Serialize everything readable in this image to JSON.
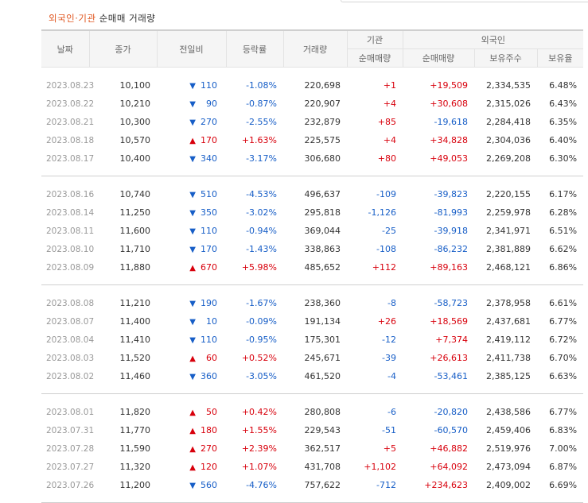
{
  "title": {
    "highlight": "외국인·기관",
    "rest": "순매매 거래량"
  },
  "headers": {
    "date": "날짜",
    "close": "종가",
    "change": "전일비",
    "rate": "등락률",
    "volume": "거래량",
    "institution": "기관",
    "foreign": "외국인",
    "inst_net": "순매매량",
    "frgn_net": "순매매량",
    "frgn_hold": "보유주수",
    "frgn_ratio": "보유율"
  },
  "colors": {
    "up": "#d8000c",
    "down": "#175ec7",
    "title_accent": "#e0561f"
  },
  "groups": [
    [
      {
        "date": "2023.08.23",
        "close": "10,100",
        "dir": "down",
        "change": "110",
        "rate": "-1.08%",
        "volume": "220,698",
        "inst": "+1",
        "frgn": "+19,509",
        "hold": "2,334,535",
        "ratio": "6.48%"
      },
      {
        "date": "2023.08.22",
        "close": "10,210",
        "dir": "down",
        "change": "90",
        "rate": "-0.87%",
        "volume": "220,907",
        "inst": "+4",
        "frgn": "+30,608",
        "hold": "2,315,026",
        "ratio": "6.43%"
      },
      {
        "date": "2023.08.21",
        "close": "10,300",
        "dir": "down",
        "change": "270",
        "rate": "-2.55%",
        "volume": "232,879",
        "inst": "+85",
        "frgn": "-19,618",
        "hold": "2,284,418",
        "ratio": "6.35%"
      },
      {
        "date": "2023.08.18",
        "close": "10,570",
        "dir": "up",
        "change": "170",
        "rate": "+1.63%",
        "volume": "225,575",
        "inst": "+4",
        "frgn": "+34,828",
        "hold": "2,304,036",
        "ratio": "6.40%"
      },
      {
        "date": "2023.08.17",
        "close": "10,400",
        "dir": "down",
        "change": "340",
        "rate": "-3.17%",
        "volume": "306,680",
        "inst": "+80",
        "frgn": "+49,053",
        "hold": "2,269,208",
        "ratio": "6.30%"
      }
    ],
    [
      {
        "date": "2023.08.16",
        "close": "10,740",
        "dir": "down",
        "change": "510",
        "rate": "-4.53%",
        "volume": "496,637",
        "inst": "-109",
        "frgn": "-39,823",
        "hold": "2,220,155",
        "ratio": "6.17%"
      },
      {
        "date": "2023.08.14",
        "close": "11,250",
        "dir": "down",
        "change": "350",
        "rate": "-3.02%",
        "volume": "295,818",
        "inst": "-1,126",
        "frgn": "-81,993",
        "hold": "2,259,978",
        "ratio": "6.28%"
      },
      {
        "date": "2023.08.11",
        "close": "11,600",
        "dir": "down",
        "change": "110",
        "rate": "-0.94%",
        "volume": "369,044",
        "inst": "-25",
        "frgn": "-39,918",
        "hold": "2,341,971",
        "ratio": "6.51%"
      },
      {
        "date": "2023.08.10",
        "close": "11,710",
        "dir": "down",
        "change": "170",
        "rate": "-1.43%",
        "volume": "338,863",
        "inst": "-108",
        "frgn": "-86,232",
        "hold": "2,381,889",
        "ratio": "6.62%"
      },
      {
        "date": "2023.08.09",
        "close": "11,880",
        "dir": "up",
        "change": "670",
        "rate": "+5.98%",
        "volume": "485,652",
        "inst": "+112",
        "frgn": "+89,163",
        "hold": "2,468,121",
        "ratio": "6.86%"
      }
    ],
    [
      {
        "date": "2023.08.08",
        "close": "11,210",
        "dir": "down",
        "change": "190",
        "rate": "-1.67%",
        "volume": "238,360",
        "inst": "-8",
        "frgn": "-58,723",
        "hold": "2,378,958",
        "ratio": "6.61%"
      },
      {
        "date": "2023.08.07",
        "close": "11,400",
        "dir": "down",
        "change": "10",
        "rate": "-0.09%",
        "volume": "191,134",
        "inst": "+26",
        "frgn": "+18,569",
        "hold": "2,437,681",
        "ratio": "6.77%"
      },
      {
        "date": "2023.08.04",
        "close": "11,410",
        "dir": "down",
        "change": "110",
        "rate": "-0.95%",
        "volume": "175,301",
        "inst": "-12",
        "frgn": "+7,374",
        "hold": "2,419,112",
        "ratio": "6.72%"
      },
      {
        "date": "2023.08.03",
        "close": "11,520",
        "dir": "up",
        "change": "60",
        "rate": "+0.52%",
        "volume": "245,671",
        "inst": "-39",
        "frgn": "+26,613",
        "hold": "2,411,738",
        "ratio": "6.70%"
      },
      {
        "date": "2023.08.02",
        "close": "11,460",
        "dir": "down",
        "change": "360",
        "rate": "-3.05%",
        "volume": "461,520",
        "inst": "-4",
        "frgn": "-53,461",
        "hold": "2,385,125",
        "ratio": "6.63%"
      }
    ],
    [
      {
        "date": "2023.08.01",
        "close": "11,820",
        "dir": "up",
        "change": "50",
        "rate": "+0.42%",
        "volume": "280,808",
        "inst": "-6",
        "frgn": "-20,820",
        "hold": "2,438,586",
        "ratio": "6.77%"
      },
      {
        "date": "2023.07.31",
        "close": "11,770",
        "dir": "up",
        "change": "180",
        "rate": "+1.55%",
        "volume": "229,543",
        "inst": "-51",
        "frgn": "-60,570",
        "hold": "2,459,406",
        "ratio": "6.83%"
      },
      {
        "date": "2023.07.28",
        "close": "11,590",
        "dir": "up",
        "change": "270",
        "rate": "+2.39%",
        "volume": "362,517",
        "inst": "+5",
        "frgn": "+46,882",
        "hold": "2,519,976",
        "ratio": "7.00%"
      },
      {
        "date": "2023.07.27",
        "close": "11,320",
        "dir": "up",
        "change": "120",
        "rate": "+1.07%",
        "volume": "431,708",
        "inst": "+1,102",
        "frgn": "+64,092",
        "hold": "2,473,094",
        "ratio": "6.87%"
      },
      {
        "date": "2023.07.26",
        "close": "11,200",
        "dir": "down",
        "change": "560",
        "rate": "-4.76%",
        "volume": "757,622",
        "inst": "-712",
        "frgn": "+234,623",
        "hold": "2,409,002",
        "ratio": "6.69%"
      }
    ]
  ]
}
